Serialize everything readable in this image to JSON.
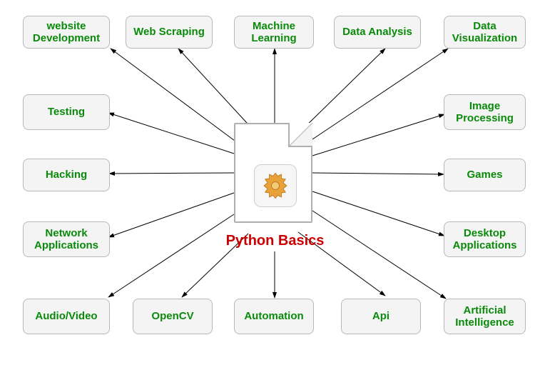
{
  "center": {
    "title": "Python Basics"
  },
  "nodes": {
    "website_dev": {
      "label": "website\nDevelopment"
    },
    "web_scraping": {
      "label": "Web Scraping"
    },
    "ml": {
      "label": "Machine\nLearning"
    },
    "data_analysis": {
      "label": "Data Analysis"
    },
    "data_viz": {
      "label": "Data\nVisualization"
    },
    "image_proc": {
      "label": "Image\nProcessing"
    },
    "games": {
      "label": "Games"
    },
    "desktop": {
      "label": "Desktop\nApplications"
    },
    "ai": {
      "label": "Artificial\nIntelligence"
    },
    "api": {
      "label": "Api"
    },
    "automation": {
      "label": "Automation"
    },
    "opencv": {
      "label": "OpenCV"
    },
    "audio_video": {
      "label": "Audio/Video"
    },
    "network": {
      "label": "Network\nApplications"
    },
    "hacking": {
      "label": "Hacking"
    },
    "testing": {
      "label": "Testing"
    }
  }
}
